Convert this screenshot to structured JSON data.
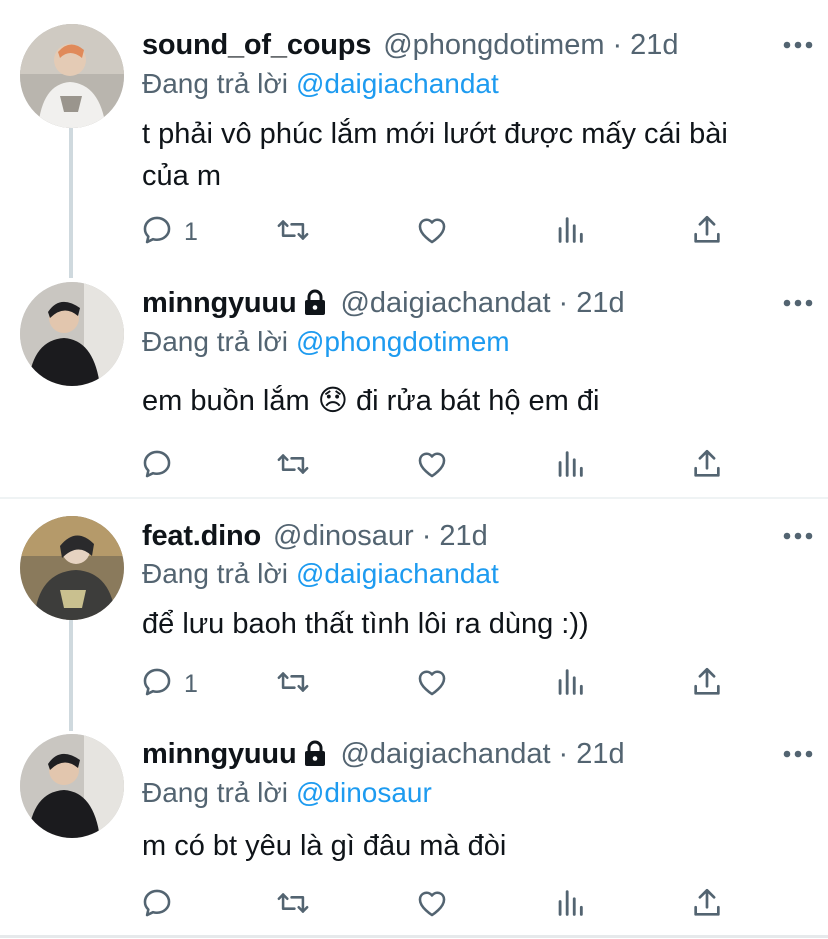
{
  "replying_label": "Đang trả lời",
  "tweets": [
    {
      "name": "sound_of_coups",
      "handle": "@phongdotimem",
      "time": "21d",
      "reply_to": "@daigiachandat",
      "text_lines": [
        "t phải vô phúc lắm mới lướt được mấy cái bài",
        "của m"
      ],
      "reply_count": "1",
      "locked": false
    },
    {
      "name": "minngyuuu",
      "handle": "@daigiachandat",
      "time": "21d",
      "reply_to": "@phongdotimem",
      "text_lines": [
        "em buồn lắm 😞 đi rửa bát hộ em đi"
      ],
      "reply_count": "",
      "locked": true
    },
    {
      "name": "feat.dino",
      "handle": "@dinosaur",
      "time": "21d",
      "reply_to": "@daigiachandat",
      "text_lines": [
        "để lưu baoh thất tình lôi ra dùng :))"
      ],
      "reply_count": "1",
      "locked": false
    },
    {
      "name": "minngyuuu",
      "handle": "@daigiachandat",
      "time": "21d",
      "reply_to": "@dinosaur",
      "text_lines": [
        "m có bt yêu là gì đâu mà đòi"
      ],
      "reply_count": "",
      "locked": true
    }
  ],
  "icons": {
    "reply": "reply-icon",
    "retweet": "retweet-icon",
    "like": "heart-icon",
    "analytics": "analytics-icon",
    "share": "share-icon",
    "more": "more-icon",
    "lock": "lock-icon"
  },
  "colors": {
    "link": "#1d9bf0",
    "secondary": "#536471",
    "primary_text": "#0f1419"
  }
}
